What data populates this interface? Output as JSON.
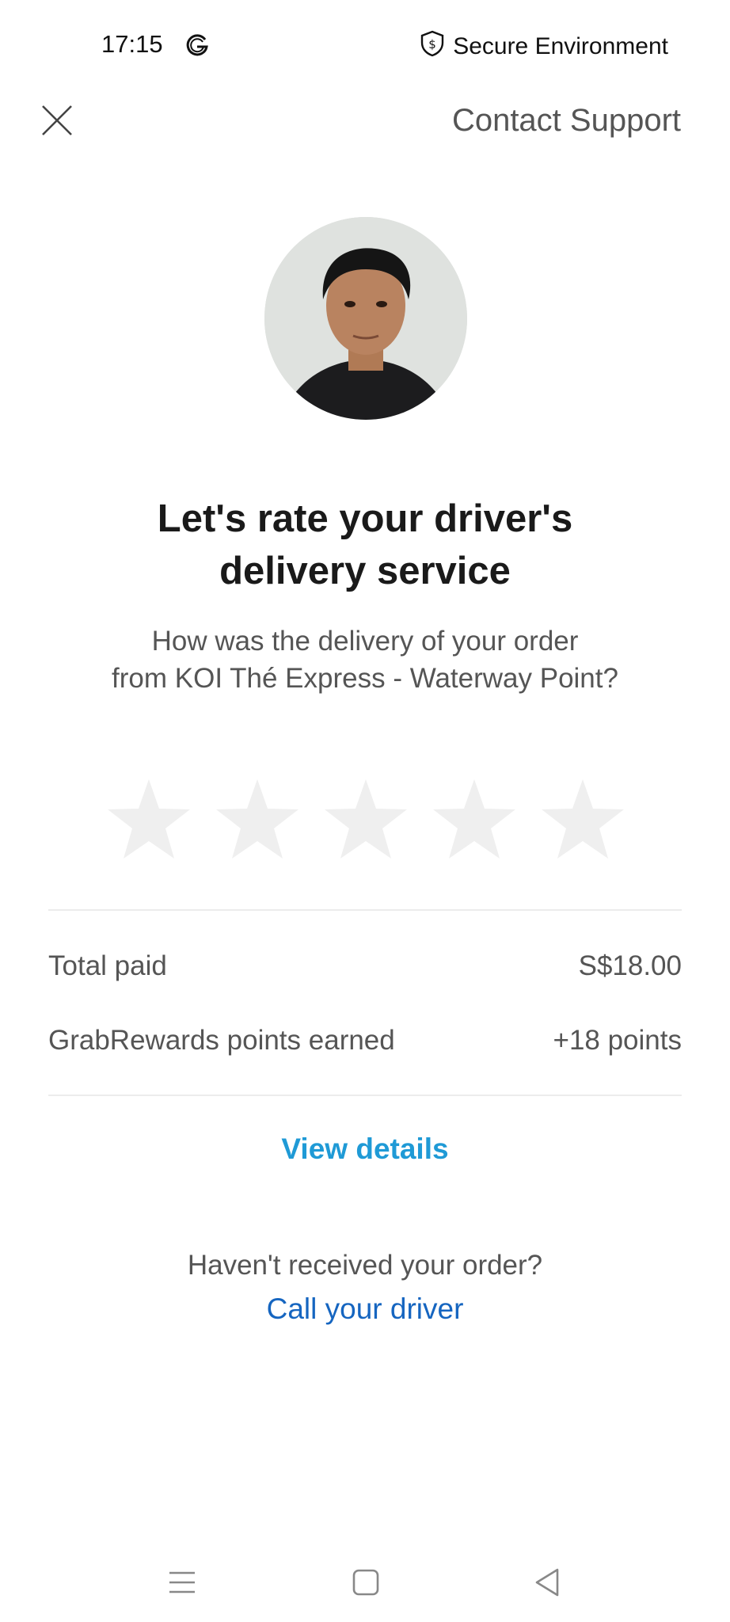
{
  "status_bar": {
    "time": "17:15",
    "app_icon": "google-icon",
    "secure_label": "Secure Environment",
    "secure_icon": "dollar-shield-icon"
  },
  "header": {
    "close_icon": "close-icon",
    "contact_support": "Contact Support"
  },
  "driver": {
    "avatar": "driver-avatar"
  },
  "rating": {
    "title_line1": "Let's rate your driver's",
    "title_line2": "delivery service",
    "subtitle_line1": "How was the delivery of your order",
    "subtitle_line2": "from KOI Thé Express - Waterway Point?",
    "max_stars": 5,
    "selected_stars": 0,
    "star_color": "#efefef"
  },
  "summary": {
    "total_label": "Total paid",
    "total_value": "S$18.00",
    "points_label": "GrabRewards points earned",
    "points_value": "+18 points"
  },
  "actions": {
    "view_details": "View details",
    "not_received": "Haven't received your order?",
    "call_driver": "Call your driver"
  },
  "nav_bar": {
    "menu_icon": "menu-icon",
    "home_icon": "home-square-icon",
    "back_icon": "back-triangle-icon"
  },
  "colors": {
    "link_teal": "#1f9ad6",
    "link_blue": "#1565c0",
    "text_gray": "#555555"
  }
}
